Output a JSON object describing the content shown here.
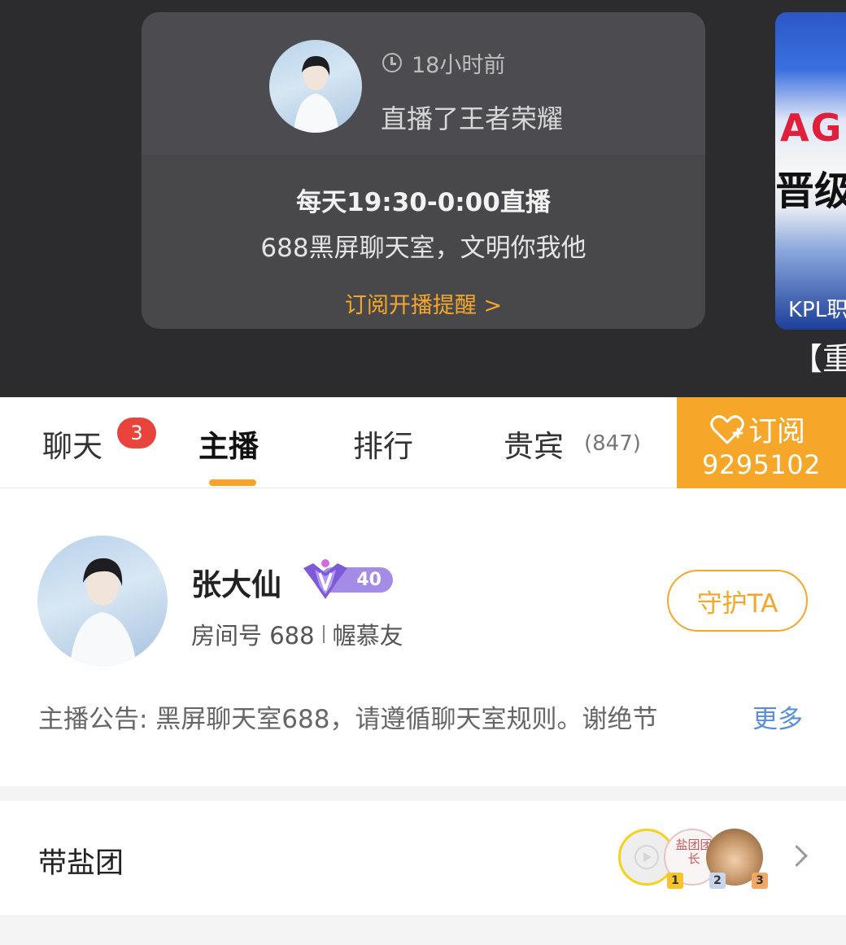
{
  "live_card": {
    "time_ago": "18小时前",
    "action": "直播了王者荣耀",
    "schedule": "每天19:30-0:00直播",
    "description": "688黑屏聊天室，文明你我他",
    "subscribe_reminder": "订阅开播提醒 >"
  },
  "side_video": {
    "thumb_text_1": "AG",
    "thumb_text_2": "晋级",
    "thumb_text_3": "KPL职",
    "caption": "【重描"
  },
  "tabs": [
    {
      "label": "聊天",
      "badge": "3"
    },
    {
      "label": "主播",
      "active": true
    },
    {
      "label": "排行"
    },
    {
      "label": "贵宾",
      "count": "(847)"
    }
  ],
  "subscribe": {
    "label": "订阅",
    "count": "9295102",
    "color": "#f6a628"
  },
  "host": {
    "name": "张大仙",
    "level": "40",
    "room_label": "房间号 688",
    "fan_name": "幄慕友",
    "guard_button": "守护TA",
    "notice": "主播公告: 黑屏聊天室688，请遵循聊天室规则。谢绝节",
    "more": "更多"
  },
  "fan_group": {
    "label": "带盐团",
    "members": [
      {
        "rank": "1"
      },
      {
        "rank": "2",
        "seal_text": "盐团团长"
      },
      {
        "rank": "3"
      }
    ]
  },
  "colors": {
    "accent": "#f3a72c",
    "badge_red": "#e9443b",
    "link_blue": "#5a8fd6",
    "dark_bg": "#2c2c2e"
  }
}
